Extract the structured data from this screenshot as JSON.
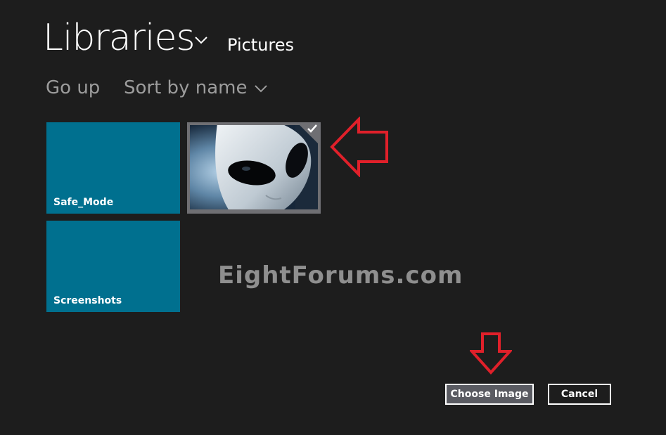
{
  "header": {
    "title": "Libraries",
    "location": "Pictures"
  },
  "commands": {
    "go_up": "Go up",
    "sort": "Sort by name"
  },
  "tiles": [
    {
      "label": "Safe_Mode",
      "type": "folder"
    },
    {
      "label": "Screenshots",
      "type": "folder"
    }
  ],
  "selected_image": {
    "selected": true,
    "icon": "check-icon"
  },
  "watermark": "EightForums.com",
  "actions": {
    "choose": "Choose Image",
    "cancel": "Cancel"
  },
  "colors": {
    "background": "#1d1d1d",
    "tile": "#00708f",
    "accent_arrow": "#e0202a"
  }
}
